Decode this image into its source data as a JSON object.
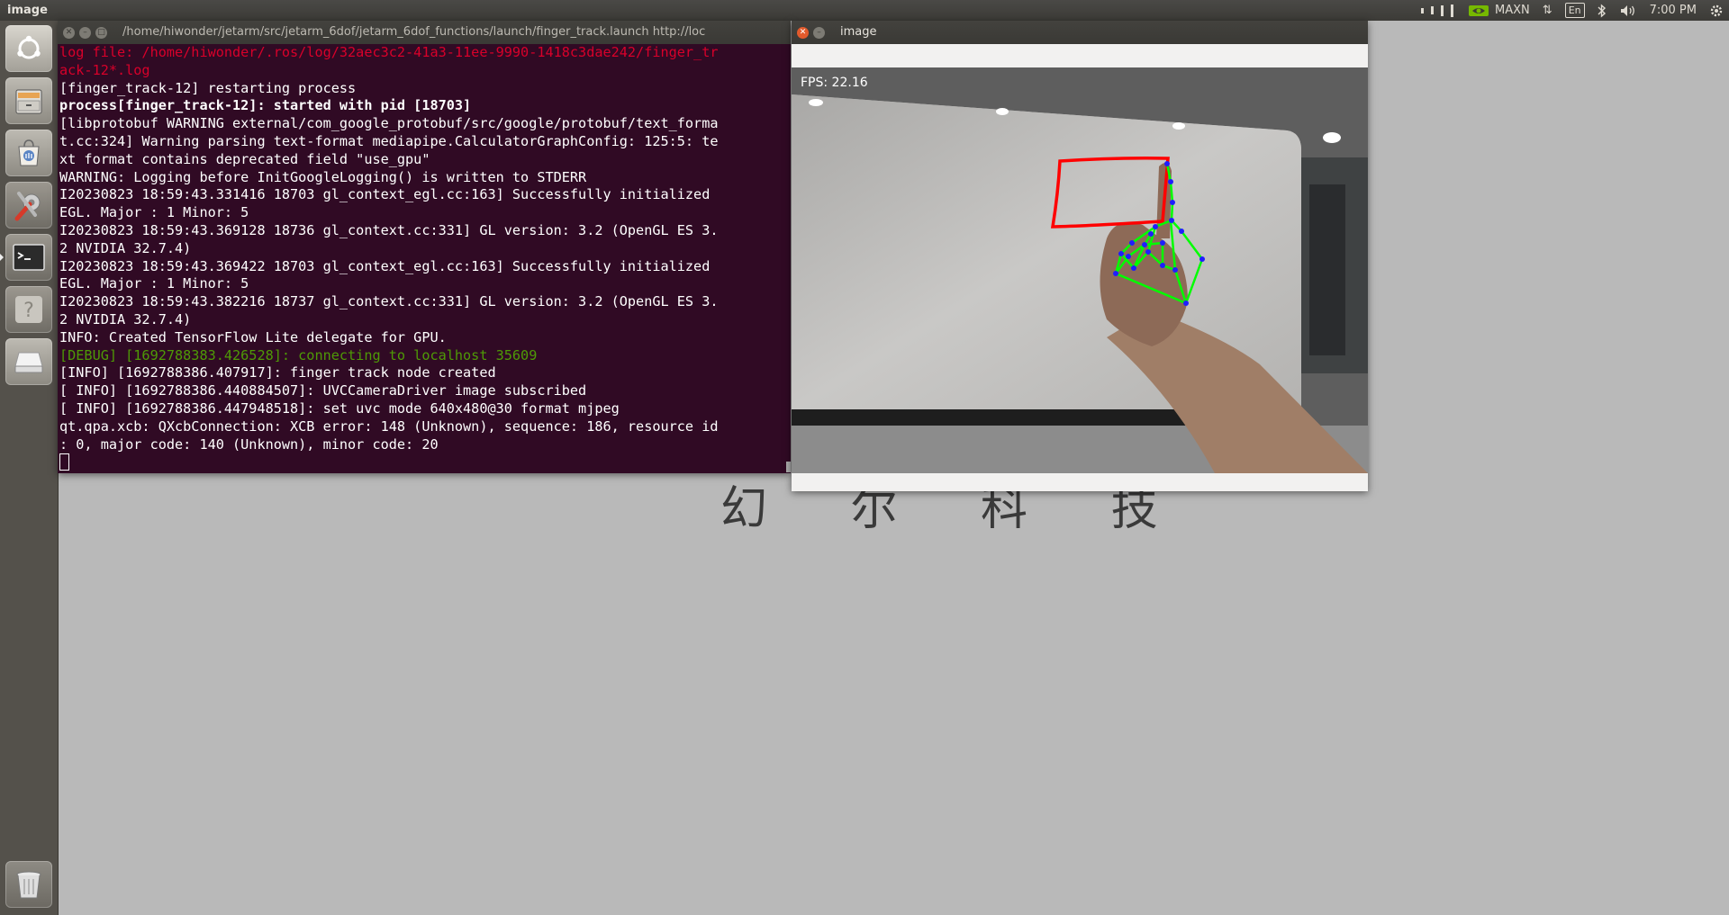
{
  "top_panel": {
    "active_app": "image",
    "power_mode": "MAXN",
    "keyboard_layout": "En",
    "clock": "7:00 PM",
    "icons": [
      "network-bars-icon",
      "nvidia-icon",
      "transfer-arrows-icon",
      "bluetooth-icon",
      "volume-icon",
      "gear-icon"
    ]
  },
  "launcher": {
    "items": [
      {
        "name": "dash-home",
        "icon": "ubuntu-logo-icon"
      },
      {
        "name": "files",
        "icon": "file-cabinet-icon"
      },
      {
        "name": "software-center",
        "icon": "shopping-bag-icon"
      },
      {
        "name": "system-settings",
        "icon": "tools-icon"
      },
      {
        "name": "terminal",
        "icon": "terminal-icon"
      },
      {
        "name": "help",
        "icon": "question-icon"
      },
      {
        "name": "removable-drive",
        "icon": "drive-icon"
      },
      {
        "name": "trash",
        "icon": "trash-icon"
      }
    ]
  },
  "wallpaper": {
    "logo_text": "幻 尔 科 技"
  },
  "terminal": {
    "title": "/home/hiwonder/jetarm/src/jetarm_6dof/jetarm_6dof_functions/launch/finger_track.launch http://loc",
    "lines": [
      {
        "text": "log file: /home/hiwonder/.ros/log/32aec3c2-41a3-11ee-9990-1418c3dae242/finger_tr",
        "style": "red"
      },
      {
        "text": "ack-12*.log",
        "style": "red"
      },
      {
        "text": "[finger_track-12] restarting process",
        "style": "normal"
      },
      {
        "text": "process[finger_track-12]: started with pid [18703]",
        "style": "bold"
      },
      {
        "text": "[libprotobuf WARNING external/com_google_protobuf/src/google/protobuf/text_forma",
        "style": "normal"
      },
      {
        "text": "t.cc:324] Warning parsing text-format mediapipe.CalculatorGraphConfig: 125:5: te",
        "style": "normal"
      },
      {
        "text": "xt format contains deprecated field \"use_gpu\"",
        "style": "normal"
      },
      {
        "text": "WARNING: Logging before InitGoogleLogging() is written to STDERR",
        "style": "normal"
      },
      {
        "text": "I20230823 18:59:43.331416 18703 gl_context_egl.cc:163] Successfully initialized",
        "style": "normal"
      },
      {
        "text": "EGL. Major : 1 Minor: 5",
        "style": "normal"
      },
      {
        "text": "I20230823 18:59:43.369128 18736 gl_context.cc:331] GL version: 3.2 (OpenGL ES 3.",
        "style": "normal"
      },
      {
        "text": "2 NVIDIA 32.7.4)",
        "style": "normal"
      },
      {
        "text": "I20230823 18:59:43.369422 18703 gl_context_egl.cc:163] Successfully initialized",
        "style": "normal"
      },
      {
        "text": "EGL. Major : 1 Minor: 5",
        "style": "normal"
      },
      {
        "text": "I20230823 18:59:43.382216 18737 gl_context.cc:331] GL version: 3.2 (OpenGL ES 3.",
        "style": "normal"
      },
      {
        "text": "2 NVIDIA 32.7.4)",
        "style": "normal"
      },
      {
        "text": "INFO: Created TensorFlow Lite delegate for GPU.",
        "style": "normal"
      },
      {
        "text": "[DEBUG] [1692788383.426528]: connecting to localhost 35609",
        "style": "green"
      },
      {
        "text": "[INFO] [1692788386.407917]: finger track node created",
        "style": "normal"
      },
      {
        "text": "[ INFO] [1692788386.440884507]: UVCCameraDriver image subscribed",
        "style": "normal"
      },
      {
        "text": "[ INFO] [1692788386.447948518]: set uvc mode 640x480@30 format mjpeg",
        "style": "normal"
      },
      {
        "text": "qt.qpa.xcb: QXcbConnection: XCB error: 148 (Unknown), sequence: 186, resource id",
        "style": "normal"
      },
      {
        "text": ": 0, major code: 140 (Unknown), minor code: 20",
        "style": "normal"
      }
    ]
  },
  "image_window": {
    "title": "image",
    "fps_text": "FPS: 22.16"
  }
}
